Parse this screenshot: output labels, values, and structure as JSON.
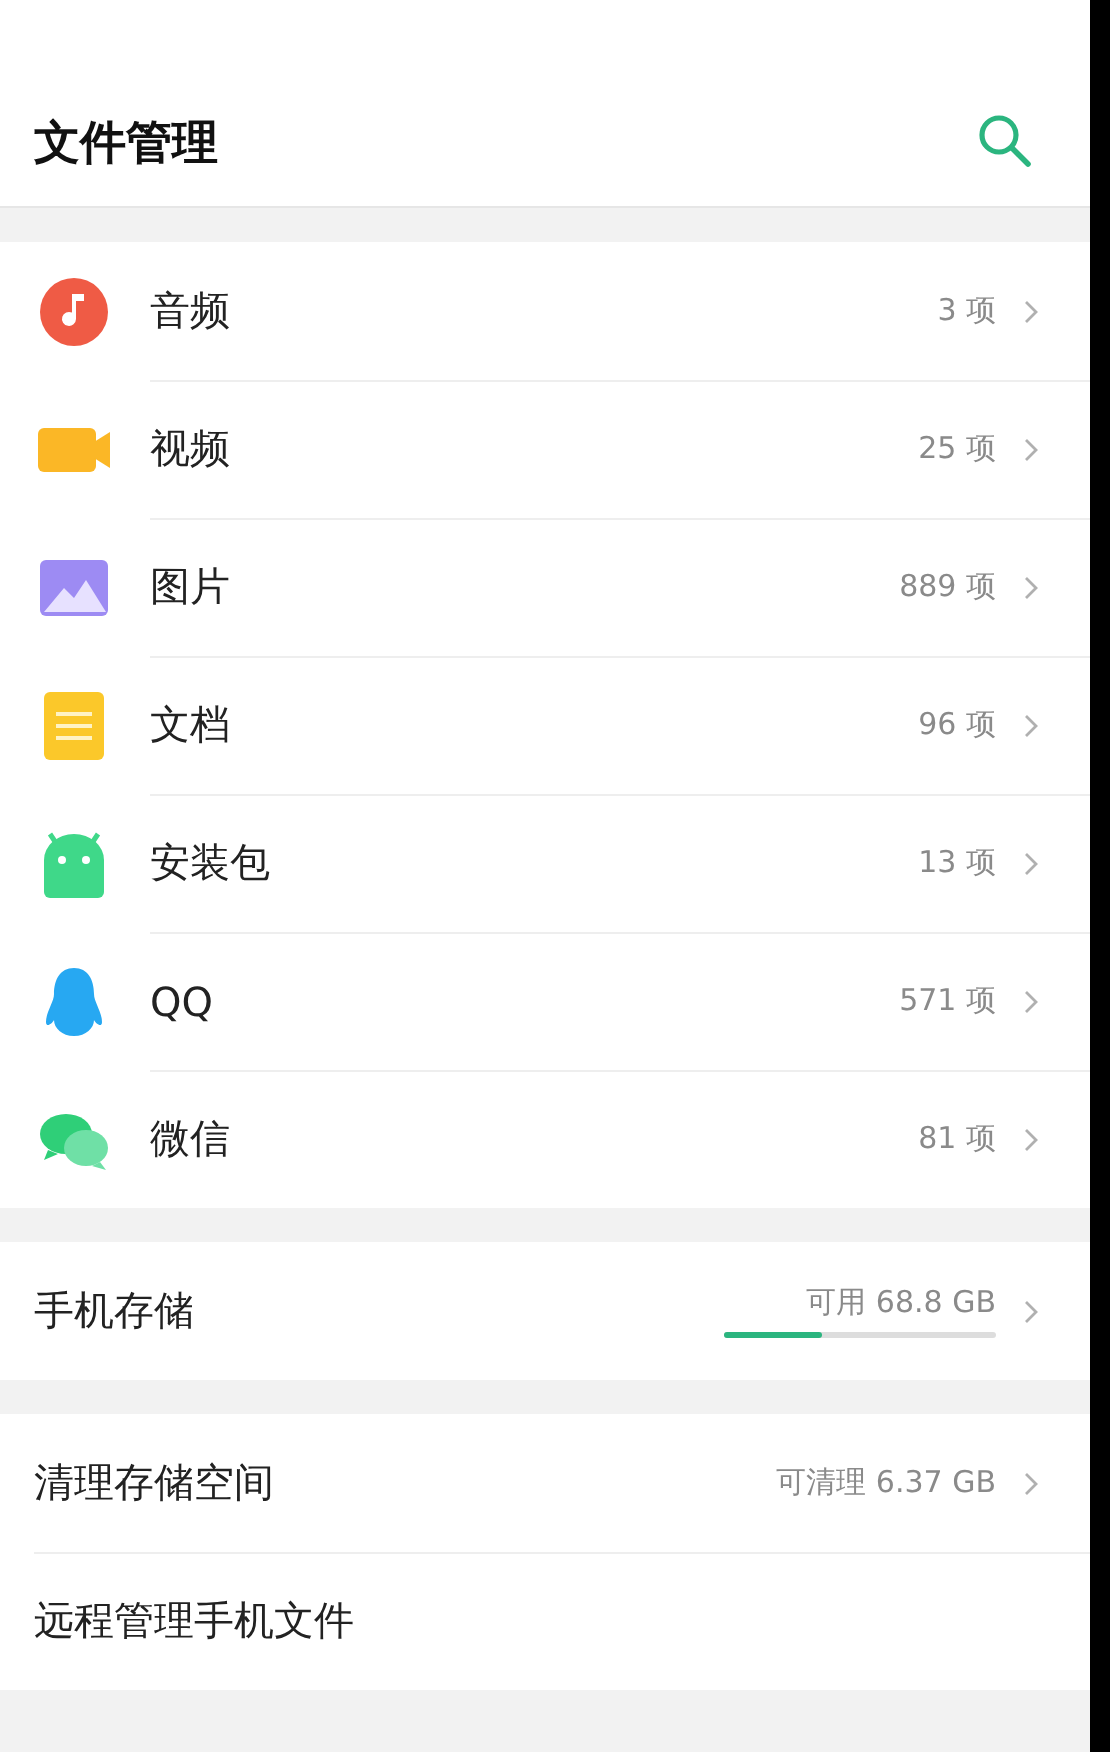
{
  "header": {
    "title": "文件管理"
  },
  "categories": [
    {
      "kind": "audio",
      "label": "音频",
      "count": "3 项"
    },
    {
      "kind": "video",
      "label": "视频",
      "count": "25 项"
    },
    {
      "kind": "image",
      "label": "图片",
      "count": "889 项"
    },
    {
      "kind": "document",
      "label": "文档",
      "count": "96 项"
    },
    {
      "kind": "apk",
      "label": "安装包",
      "count": "13 项"
    },
    {
      "kind": "qq",
      "label": "QQ",
      "count": "571 项"
    },
    {
      "kind": "wechat",
      "label": "微信",
      "count": "81 项"
    }
  ],
  "storage": {
    "label": "手机存储",
    "value": "可用 68.8 GB",
    "level": 0.36
  },
  "tools": [
    {
      "label": "清理存储空间",
      "value": "可清理 6.37 GB",
      "chevron": true
    },
    {
      "label": "远程管理手机文件",
      "chevron": false
    }
  ]
}
